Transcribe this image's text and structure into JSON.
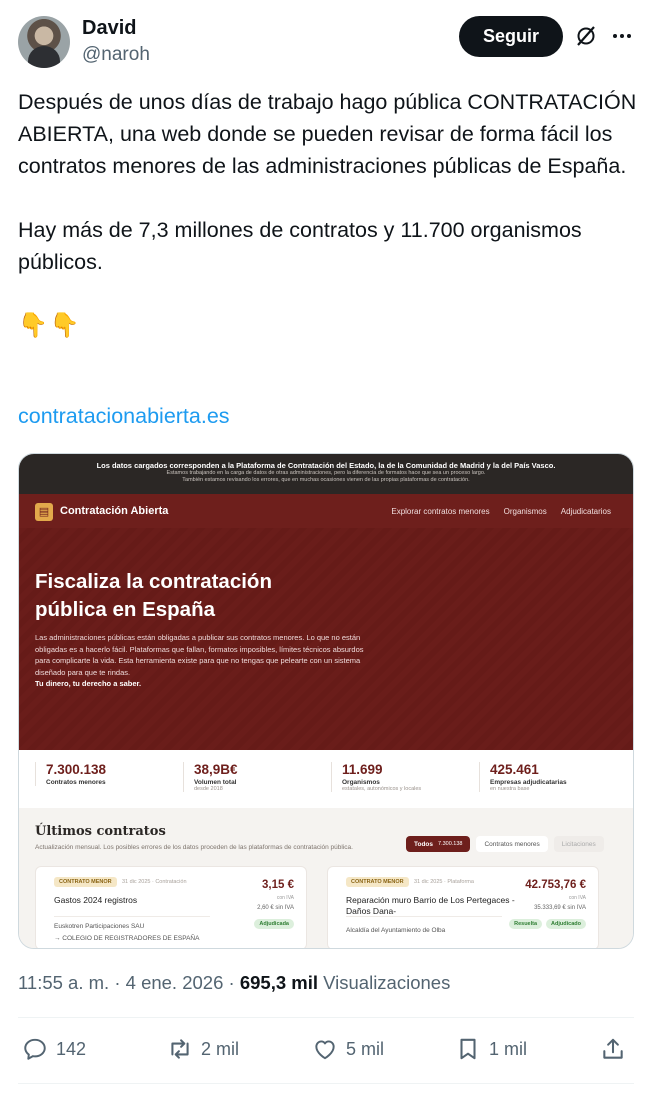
{
  "author": {
    "name": "David",
    "handle": "@naroh",
    "follow_label": "Seguir"
  },
  "icons": {
    "grok": "grok-icon",
    "more": "more-icon",
    "reply": "reply-icon",
    "retweet": "retweet-icon",
    "like": "heart-icon",
    "bookmark": "bookmark-icon",
    "share": "share-icon"
  },
  "tweet": {
    "paragraph1": "Después de unos días de trabajo hago pública CONTRATACIÓN ABIERTA, una web donde se pueden revisar de forma fácil los contratos menores de las administraciones públicas de España.",
    "paragraph2": "Hay más de 7,3 millones de contratos y 11.700 organismos públicos.",
    "emojis": "👇👇",
    "link": "contratacionabierta.es"
  },
  "card": {
    "banner_line1": "Los datos cargados corresponden a la Plataforma de Contratación del Estado, la de la Comunidad de Madrid y la del País Vasco.",
    "banner_line2": "Estamos trabajando en la carga de datos de otras administraciones, pero la diferencia de formatos hace que sea un proceso largo.",
    "banner_line3": "También estamos revisando los errores, que en muchas ocasiones vienen de las propias plataformas de contratación.",
    "brand": "Contratación Abierta",
    "nav_links": [
      "Explorar contratos menores",
      "Organismos",
      "Adjudicatarios"
    ],
    "hero_title": "Fiscaliza la contratación pública en España",
    "hero_desc": "Las administraciones públicas están obligadas a publicar sus contratos menores. Lo que no están obligadas es a hacerlo fácil. Plataformas que fallan, formatos imposibles, límites técnicos absurdos para complicarte la vida. Esta herramienta existe para que no tengas que pelearte con un sistema diseñado para que te rindas.",
    "hero_tagline": "Tu dinero, tu derecho a saber.",
    "stats": [
      {
        "value": "7.300.138",
        "label": "Contratos menores",
        "sub": ""
      },
      {
        "value": "38,9B€",
        "label": "Volumen total",
        "sub": "desde 2018"
      },
      {
        "value": "11.699",
        "label": "Organismos",
        "sub": "estatales, autonómicos y locales"
      },
      {
        "value": "425.461",
        "label": "Empresas adjudicatarias",
        "sub": "en nuestra base"
      }
    ],
    "latest_title": "Últimos contratos",
    "latest_sub": "Actualización mensual. Los posibles errores de los datos proceden de las plataformas de contratación pública.",
    "filters": [
      {
        "label": "Todos",
        "count": "7.300.138"
      },
      {
        "label": "Contratos menores",
        "count": ""
      },
      {
        "label": "Licitaciones",
        "count": ""
      }
    ],
    "contracts": [
      {
        "tag": "CONTRATO MENOR",
        "meta": "31 dic 2025  ·  Contratación",
        "title": "Gastos 2024 registros",
        "amount": "3,15 €",
        "iva": "con IVA",
        "sin_iva": "2,60 € sin IVA",
        "org": "Euskotren Participaciones SAU",
        "org2": "→ COLEGIO DE REGISTRADORES DE ESPAÑA",
        "badges": [
          "Adjudicada"
        ]
      },
      {
        "tag": "CONTRATO MENOR",
        "meta": "31 dic 2025  ·  Plataforma",
        "title": "Reparación muro Barrio de Los Pertegaces - Daños Dana-",
        "amount": "42.753,76 €",
        "iva": "con IVA",
        "sin_iva": "35.333,69 € sin IVA",
        "org": "Alcaldía del Ayuntamiento de Olba",
        "org2": "",
        "badges": [
          "Resuelta",
          "Adjudicado"
        ]
      }
    ]
  },
  "meta": {
    "time": "11:55 a. m.",
    "date": "4 ene. 2026",
    "views_count": "695,3 mil",
    "views_label": "Visualizaciones"
  },
  "actions": {
    "replies": "142",
    "retweets": "2 mil",
    "likes": "5 mil",
    "bookmarks": "1 mil"
  }
}
